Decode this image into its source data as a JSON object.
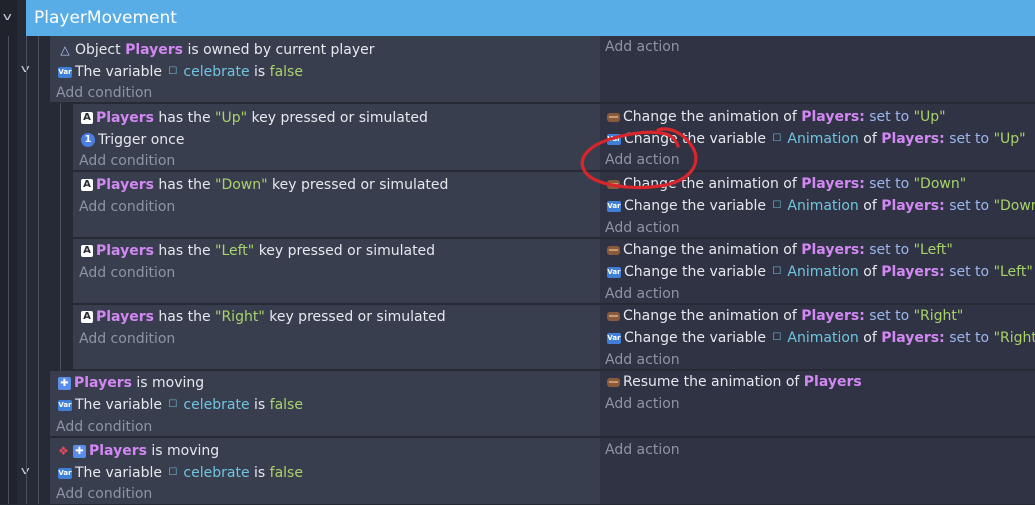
{
  "group": {
    "title": "PlayerMovement"
  },
  "labels": {
    "add_condition": "Add condition",
    "add_action": "Add action",
    "object": "Object",
    "owned": "is owned by current player",
    "the_variable": "The variable",
    "is": "is",
    "has_the": "has the",
    "key_pressed": "key pressed or simulated",
    "trigger_once": "Trigger once",
    "change_anim": "Change the animation of",
    "change_var": "Change the variable",
    "of": "of",
    "set_to": "set to",
    "is_moving": "is moving",
    "resume_anim": "Resume the animation of"
  },
  "values": {
    "players": "Players",
    "celebrate": "celebrate",
    "false": "false",
    "animation": "Animation",
    "colon": ":"
  },
  "keys": {
    "up": "\"Up\"",
    "down": "\"Down\"",
    "left": "\"Left\"",
    "right": "\"Right\""
  },
  "icons": {
    "key": "A",
    "trigger": "1",
    "var": "Var"
  },
  "colors": {
    "header": "#58ade6",
    "object": "#d288f3",
    "string": "#a8d36a",
    "variable": "#6fc5e0",
    "annotation": "#d8262c"
  }
}
